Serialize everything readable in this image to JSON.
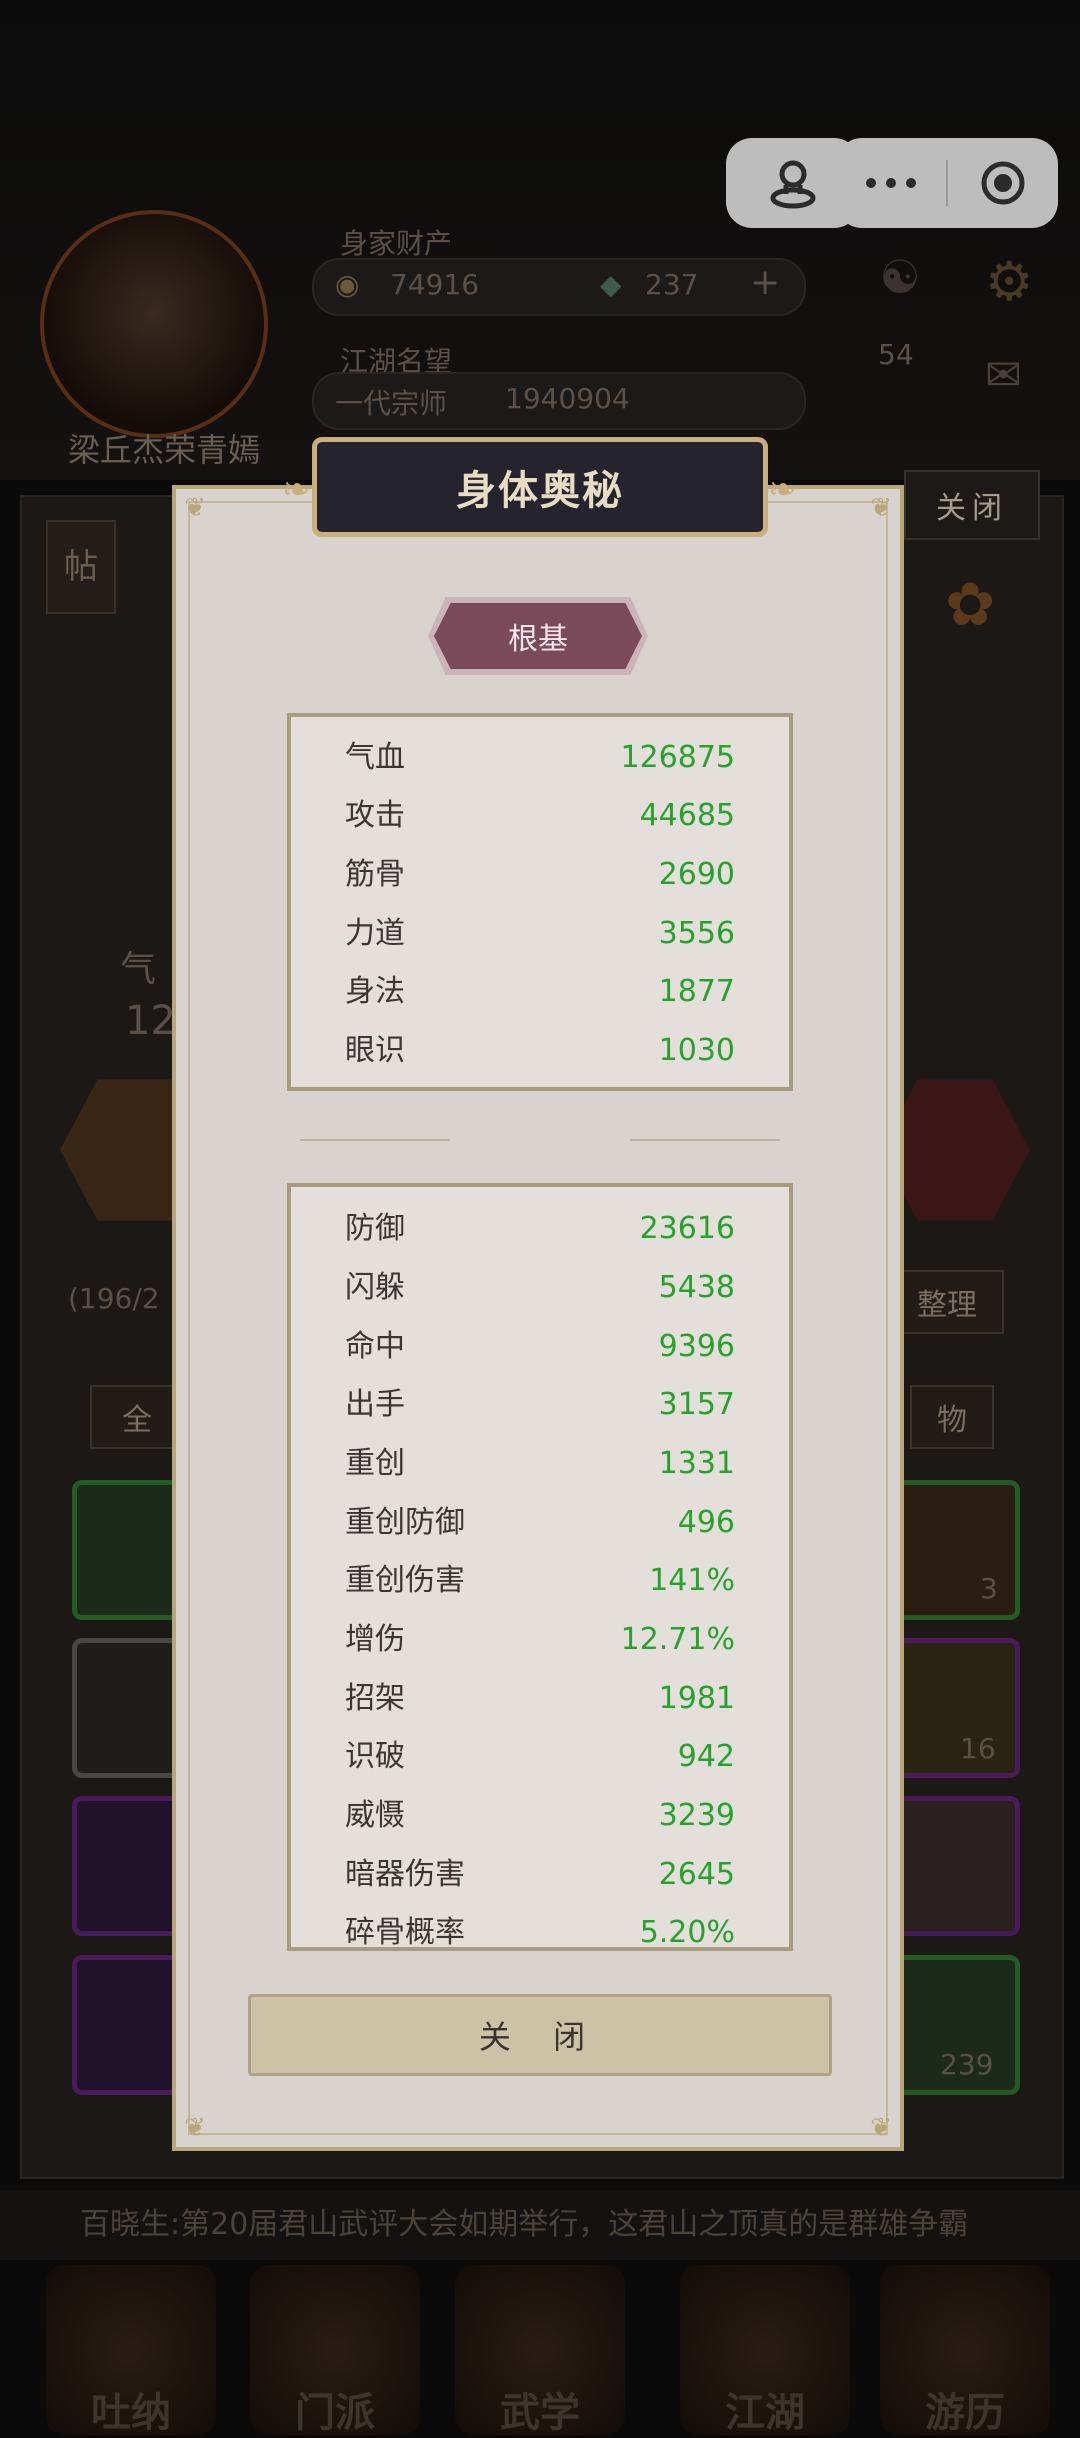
{
  "background": {
    "assets_label": "身家财产",
    "coins": "74916",
    "gems": "237",
    "fame_label": "江湖名望",
    "fame_rank": "一代宗师",
    "fame_value": "1940904",
    "player_name": "梁丘杰荣青嫣",
    "yin_yang_level": "54",
    "post_label": "帖",
    "hp_label_partial": "气",
    "hp_value_partial": "12",
    "inventory_count": "(196/2",
    "filter_all": "全",
    "filter_items": "物",
    "arrange_button": "整理",
    "badge_counts": [
      "3",
      "16",
      "239"
    ],
    "notice": "百晓生:第20届君山武评大会如期举行，这君山之顶真的是群雄争霸",
    "nav": [
      "吐纳",
      "门派",
      "武学",
      "江湖",
      "游历"
    ],
    "close_top": "关闭"
  },
  "capsule": {
    "single_icon": "mini-program-icon",
    "more_icon": "more-dots-icon",
    "record_icon": "record-icon"
  },
  "modal": {
    "title": "身体奥秘",
    "section_tag": "根基",
    "base_stats": [
      {
        "label": "气血",
        "value": "126875"
      },
      {
        "label": "攻击",
        "value": "44685"
      },
      {
        "label": "筋骨",
        "value": "2690"
      },
      {
        "label": "力道",
        "value": "3556"
      },
      {
        "label": "身法",
        "value": "1877"
      },
      {
        "label": "眼识",
        "value": "1030"
      }
    ],
    "combat_stats": [
      {
        "label": "防御",
        "value": "23616"
      },
      {
        "label": "闪躲",
        "value": "5438"
      },
      {
        "label": "命中",
        "value": "9396"
      },
      {
        "label": "出手",
        "value": "3157"
      },
      {
        "label": "重创",
        "value": "1331"
      },
      {
        "label": "重创防御",
        "value": "496"
      },
      {
        "label": "重创伤害",
        "value": "141%"
      },
      {
        "label": "增伤",
        "value": "12.71%"
      },
      {
        "label": "招架",
        "value": "1981"
      },
      {
        "label": "识破",
        "value": "942"
      },
      {
        "label": "威慑",
        "value": "3239"
      },
      {
        "label": "暗器伤害",
        "value": "2645"
      },
      {
        "label": "碎骨概率",
        "value": "5.20%"
      }
    ],
    "close_label": "关 闭"
  },
  "colors": {
    "stat_value": "#27a32d",
    "tag_bg": "#7b4a5a",
    "title_bg": "#25232e",
    "gold_border": "#c9b07a"
  }
}
